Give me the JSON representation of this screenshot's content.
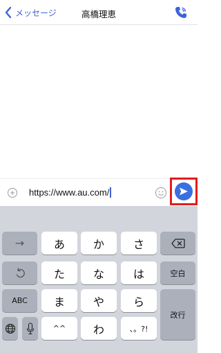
{
  "header": {
    "back_label": "メッセージ",
    "title": "高橋理恵",
    "call_icon": "phone-icon"
  },
  "composer": {
    "text": "https://www.au.com/",
    "plus_icon": "add-circle-icon",
    "emoji_icon": "emoji-icon",
    "send_icon": "send-icon",
    "highlight_color": "#e31c1c"
  },
  "keyboard": {
    "row1": {
      "left": "→",
      "k1": "あ",
      "k2": "か",
      "k3": "さ",
      "right_icon": "backspace-icon"
    },
    "row2": {
      "left_icon": "undo-icon",
      "k1": "た",
      "k2": "な",
      "k3": "は",
      "right": "空白"
    },
    "row3": {
      "left": "ABC",
      "k1": "ま",
      "k2": "や",
      "k3": "ら",
      "right": "改行"
    },
    "row4": {
      "globe_icon": "globe-icon",
      "mic_icon": "microphone-icon",
      "k1": "^^",
      "k2": "わ",
      "k3": "、。?!"
    }
  },
  "colors": {
    "accent": "#3d63d9",
    "send": "#3b6fe0",
    "keyboard_bg": "#d2d5db",
    "gray_key": "#abb0bb"
  }
}
